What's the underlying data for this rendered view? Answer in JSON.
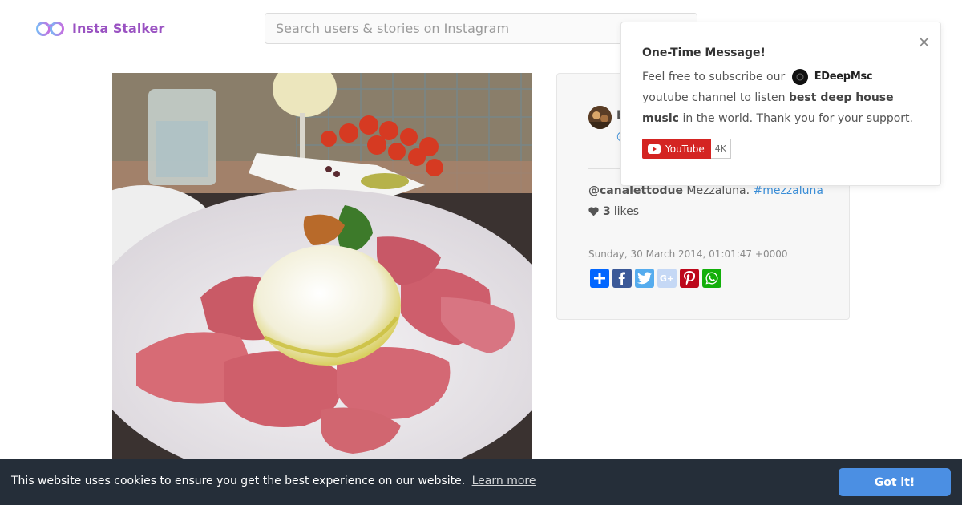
{
  "header": {
    "brand": "Insta Stalker",
    "search_placeholder": "Search users & stories on Instagram"
  },
  "post": {
    "user_initial": "E",
    "user_handle": "@",
    "caption_mention": "@canalettodue",
    "caption_text": " Mezzaluna. ",
    "caption_tag": "#mezzaluna",
    "likes_count": "3",
    "likes_label": "likes",
    "date": "Sunday, 30 March 2014, 01:01:47 +0000",
    "share_buttons": [
      "share-icon",
      "facebook-icon",
      "twitter-icon",
      "google-plus-icon",
      "pinterest-icon",
      "whatsapp-icon"
    ]
  },
  "popup": {
    "title": "One-Time Message!",
    "text_before": "Feel free to subscribe our",
    "channel_name": "EDeepMsc",
    "text_after": "youtube channel to listen",
    "highlight": "best deep house music",
    "text_end": "in the world. Thank you for your support.",
    "youtube_label": "YouTube",
    "subscriber_count": "4K",
    "close_glyph": "×"
  },
  "cookie": {
    "message": "This website uses cookies to ensure you get the best experience on our website.",
    "learn_more": "Learn more",
    "accept": "Got it!"
  },
  "colors": {
    "brand": "#9a52c2",
    "link": "#3a8ed8",
    "cookie_bg": "#252e39",
    "cookie_button": "#4b8fe3",
    "youtube_red": "#d42422"
  }
}
